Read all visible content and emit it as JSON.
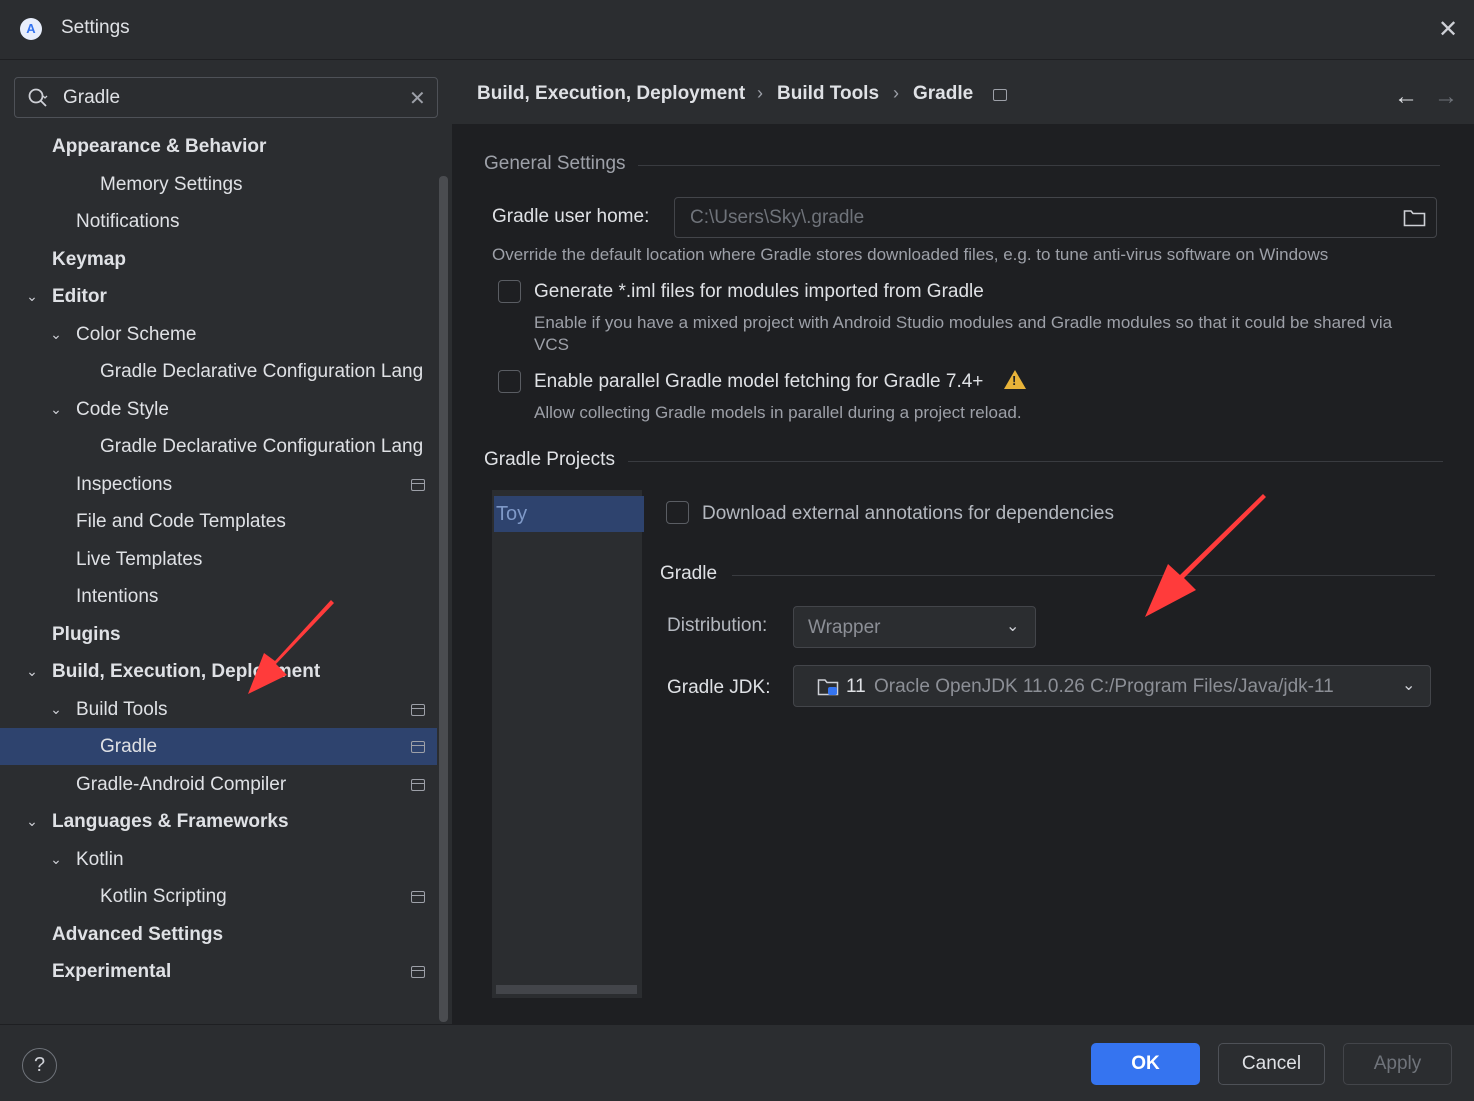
{
  "window": {
    "title": "Settings",
    "app_icon": "android-studio-icon",
    "close_icon": "close-icon"
  },
  "search": {
    "value": "Gradle",
    "icon": "search-icon",
    "clear_icon": "clear-icon"
  },
  "tree": [
    {
      "label": "Appearance & Behavior",
      "level": 0,
      "bold": true,
      "expanded": false,
      "has_chevron": false,
      "project_icon": false,
      "selected": false
    },
    {
      "label": "Memory Settings",
      "level": 2,
      "bold": false,
      "has_chevron": false,
      "project_icon": false,
      "selected": false
    },
    {
      "label": "Notifications",
      "level": 1,
      "bold": false,
      "has_chevron": false,
      "project_icon": false,
      "selected": false
    },
    {
      "label": "Keymap",
      "level": 0,
      "bold": true,
      "has_chevron": false,
      "project_icon": false,
      "selected": false
    },
    {
      "label": "Editor",
      "level": 0,
      "bold": true,
      "has_chevron": true,
      "project_icon": false,
      "selected": false
    },
    {
      "label": "Color Scheme",
      "level": 1,
      "bold": false,
      "has_chevron": true,
      "project_icon": false,
      "selected": false
    },
    {
      "label": "Gradle Declarative Configuration Lang",
      "level": 2,
      "bold": false,
      "has_chevron": false,
      "project_icon": false,
      "selected": false
    },
    {
      "label": "Code Style",
      "level": 1,
      "bold": false,
      "has_chevron": true,
      "project_icon": false,
      "selected": false
    },
    {
      "label": "Gradle Declarative Configuration Lang",
      "level": 2,
      "bold": false,
      "has_chevron": false,
      "project_icon": false,
      "selected": false
    },
    {
      "label": "Inspections",
      "level": 1,
      "bold": false,
      "has_chevron": false,
      "project_icon": true,
      "selected": false
    },
    {
      "label": "File and Code Templates",
      "level": 1,
      "bold": false,
      "has_chevron": false,
      "project_icon": false,
      "selected": false
    },
    {
      "label": "Live Templates",
      "level": 1,
      "bold": false,
      "has_chevron": false,
      "project_icon": false,
      "selected": false
    },
    {
      "label": "Intentions",
      "level": 1,
      "bold": false,
      "has_chevron": false,
      "project_icon": false,
      "selected": false
    },
    {
      "label": "Plugins",
      "level": 0,
      "bold": true,
      "has_chevron": false,
      "project_icon": false,
      "selected": false
    },
    {
      "label": "Build, Execution, Deployment",
      "level": 0,
      "bold": true,
      "has_chevron": true,
      "project_icon": false,
      "selected": false
    },
    {
      "label": "Build Tools",
      "level": 1,
      "bold": false,
      "has_chevron": true,
      "project_icon": true,
      "selected": false
    },
    {
      "label": "Gradle",
      "level": 2,
      "bold": false,
      "has_chevron": false,
      "project_icon": true,
      "selected": true
    },
    {
      "label": "Gradle-Android Compiler",
      "level": 1,
      "bold": false,
      "has_chevron": false,
      "project_icon": true,
      "selected": false
    },
    {
      "label": "Languages & Frameworks",
      "level": 0,
      "bold": true,
      "has_chevron": true,
      "project_icon": false,
      "selected": false
    },
    {
      "label": "Kotlin",
      "level": 1,
      "bold": false,
      "has_chevron": true,
      "project_icon": false,
      "selected": false
    },
    {
      "label": "Kotlin Scripting",
      "level": 2,
      "bold": false,
      "has_chevron": false,
      "project_icon": true,
      "selected": false
    },
    {
      "label": "Advanced Settings",
      "level": 0,
      "bold": true,
      "has_chevron": false,
      "project_icon": false,
      "selected": false
    },
    {
      "label": "Experimental",
      "level": 0,
      "bold": true,
      "has_chevron": false,
      "project_icon": true,
      "selected": false
    }
  ],
  "breadcrumb": [
    "Build, Execution, Deployment",
    "Build Tools",
    "Gradle"
  ],
  "breadcrumb_separator": "›",
  "nav": {
    "back_icon": "arrow-left-icon",
    "forward_icon": "arrow-right-icon"
  },
  "general": {
    "title": "General Settings",
    "user_home_label": "Gradle user home:",
    "user_home_value": "C:\\Users\\Sky\\.gradle",
    "user_home_hint": "Override the default location where Gradle stores downloaded files, e.g. to tune anti-virus software on Windows",
    "iml_label": "Generate *.iml files for modules imported from Gradle",
    "iml_checked": false,
    "iml_hint_line1": "Enable if you have a mixed project with Android Studio modules and Gradle modules so that it could be shared via",
    "iml_hint_line2": "VCS",
    "parallel_label": "Enable parallel Gradle model fetching for Gradle 7.4+",
    "parallel_checked": false,
    "parallel_hint": "Allow collecting Gradle models in parallel during a project reload."
  },
  "projects": {
    "title": "Gradle Projects",
    "items": [
      "Toy"
    ],
    "download_annotations_label": "Download external annotations for dependencies",
    "download_annotations_checked": false,
    "gradle_section_title": "Gradle",
    "distribution_label": "Distribution:",
    "distribution_value": "Wrapper",
    "jdk_label": "Gradle JDK:",
    "jdk_version": "11",
    "jdk_value": "Oracle OpenJDK 11.0.26 C:/Program Files/Java/jdk-11"
  },
  "footer": {
    "help": "?",
    "ok": "OK",
    "cancel": "Cancel",
    "apply": "Apply"
  },
  "colors": {
    "accent": "#3574f0",
    "selection": "#2e436e",
    "annotation_arrow": "#ff3b3b",
    "warning": "#e8b339"
  }
}
